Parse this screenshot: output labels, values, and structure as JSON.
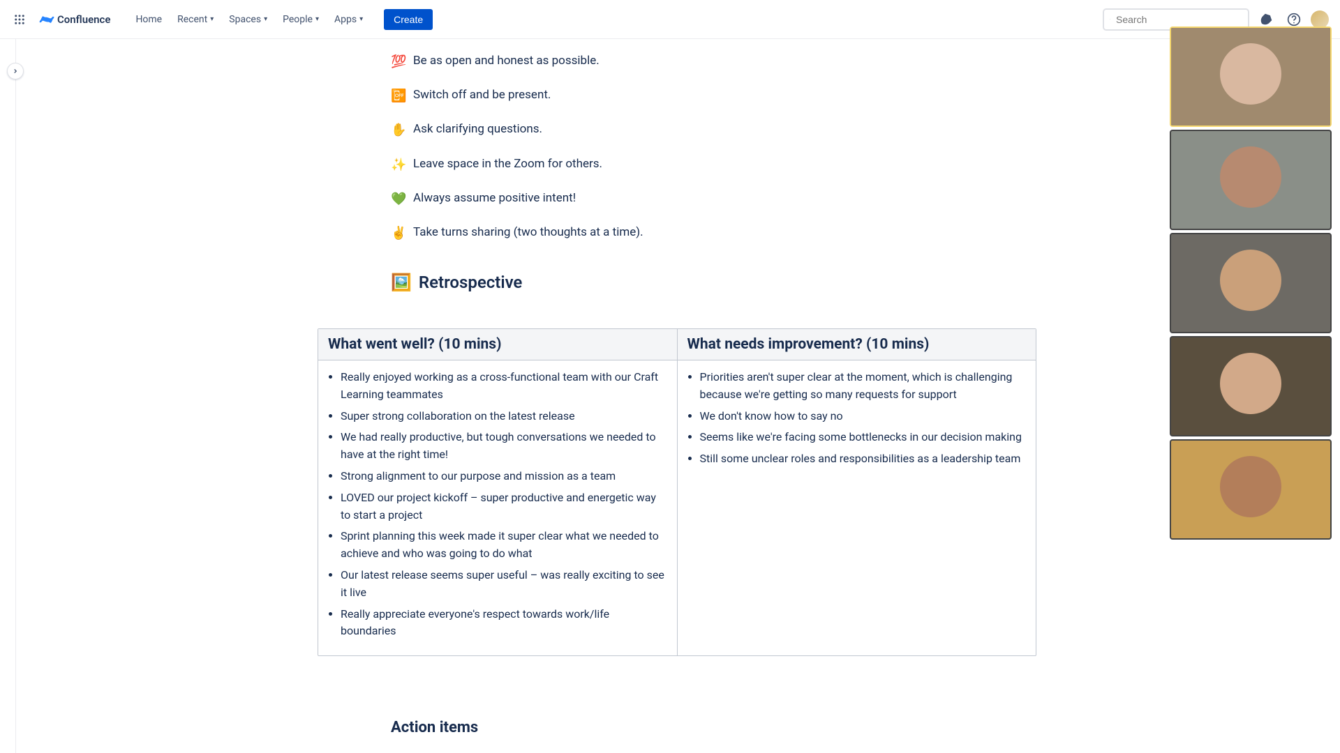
{
  "header": {
    "product": "Confluence",
    "nav": {
      "home": "Home",
      "recent": "Recent",
      "spaces": "Spaces",
      "people": "People",
      "apps": "Apps"
    },
    "create": "Create",
    "search_placeholder": "Search"
  },
  "rules": [
    {
      "emoji": "💯",
      "text": "Be as open and honest as possible."
    },
    {
      "emoji": "📴",
      "text": "Switch off and be present."
    },
    {
      "emoji": "✋",
      "text": "Ask clarifying questions."
    },
    {
      "emoji": "✨",
      "text": "Leave space in the Zoom for others."
    },
    {
      "emoji": "💚",
      "text": "Always assume positive intent!"
    },
    {
      "emoji": "✌️",
      "text": "Take turns sharing (two thoughts at a time)."
    }
  ],
  "section_retro_emoji": "🖼️",
  "section_retro_label": "Retrospective",
  "retro": {
    "well_header": "What went well? (10 mins)",
    "improve_header": "What needs improvement? (10 mins)",
    "well_items": [
      "Really enjoyed working as a cross-functional team with our Craft Learning teammates",
      "Super strong collaboration on the latest release",
      "We had really productive, but tough conversations we needed to have at the right time!",
      "Strong alignment to our purpose and mission as a team",
      "LOVED our project kickoff – super productive and energetic way to start a project",
      "Sprint planning this week made it super clear what we needed to achieve and who was going to do what",
      "Our latest release seems super useful – was really exciting to see it live",
      "Really appreciate everyone's respect towards work/life boundaries"
    ],
    "improve_items": [
      "Priorities aren't super clear at the moment, which is challenging because we're getting so many requests for support",
      "We don't know how to say no",
      "Seems like we're facing some bottlenecks in our decision making",
      "Still some unclear roles and responsibilities as a leadership team"
    ]
  },
  "action_heading": "Action items",
  "video_participants": [
    {
      "bg": "#a08a6e",
      "skin": "#d9b8a0"
    },
    {
      "bg": "#8a8f88",
      "skin": "#b78a70"
    },
    {
      "bg": "#6d6a64",
      "skin": "#caa07a"
    },
    {
      "bg": "#5a4f3e",
      "skin": "#d2a989"
    },
    {
      "bg": "#c99f55",
      "skin": "#b37e5a"
    }
  ]
}
